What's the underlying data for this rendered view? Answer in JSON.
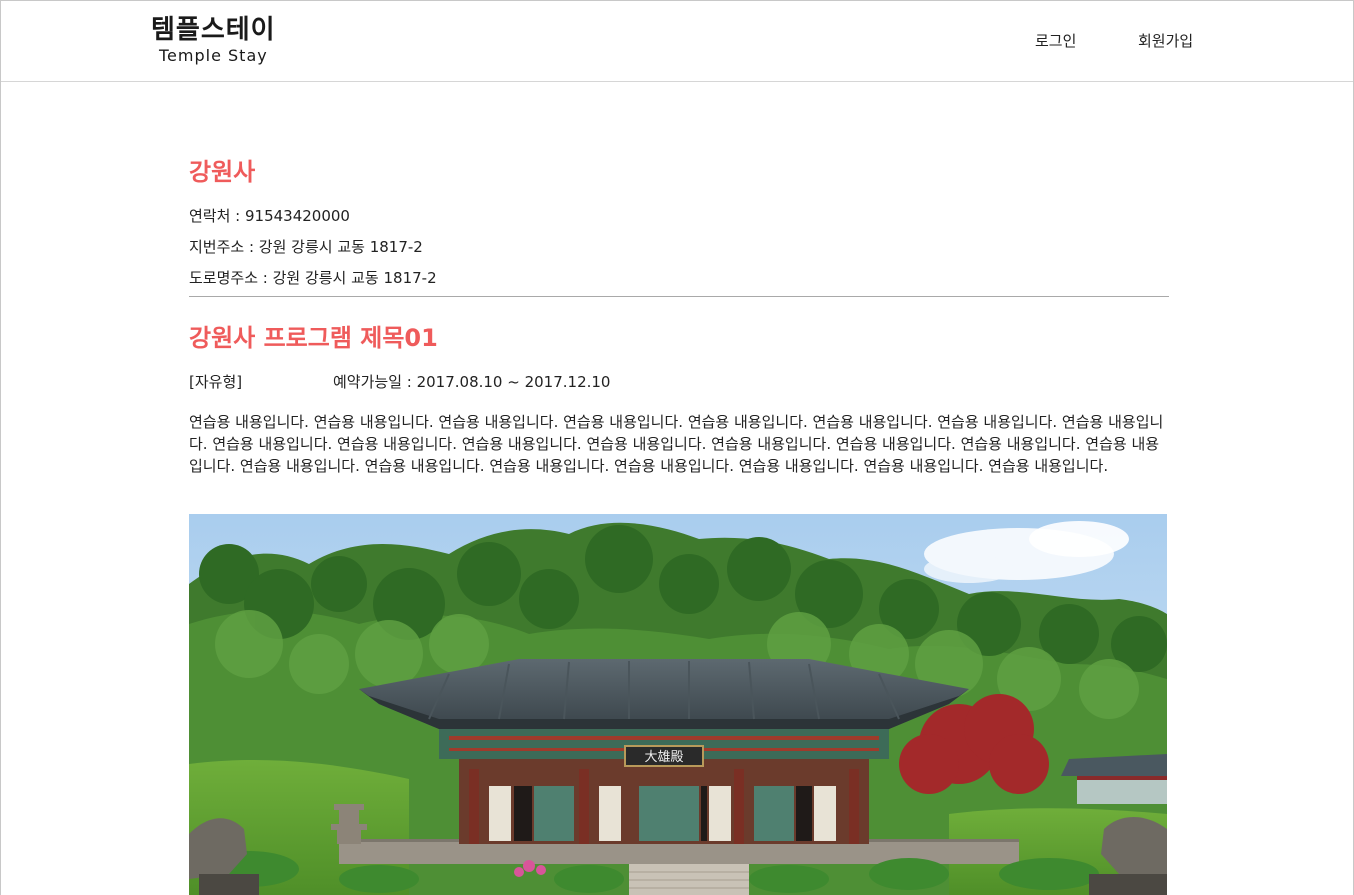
{
  "header": {
    "logo_korean": "템플스테이",
    "logo_english": "Temple Stay",
    "nav_login": "로그인",
    "nav_signup": "회원가입"
  },
  "temple": {
    "name": "강원사",
    "phone": "연락처 : 91543420000",
    "jibun_address": "지번주소 : 강원 강릉시 교동 1817-2",
    "road_address": "도로명주소 : 강원 강릉시 교동 1817-2"
  },
  "program": {
    "title": "강원사 프로그램 제목01",
    "type": "[자유형]",
    "period": "예약가능일 : 2017.08.10 ~ 2017.12.10",
    "description": "연습용 내용입니다. 연습용 내용입니다. 연습용 내용입니다. 연습용 내용입니다. 연습용 내용입니다. 연습용 내용입니다. 연습용 내용입니다. 연습용 내용입니다. 연습용 내용입니다. 연습용 내용입니다. 연습용 내용입니다. 연습용 내용입니다. 연습용 내용입니다. 연습용 내용입니다. 연습용 내용입니다. 연습용 내용입니다. 연습용 내용입니다. 연습용 내용입니다. 연습용 내용입니다. 연습용 내용입니다. 연습용 내용입니다. 연습용 내용입니다. 연습용 내용입니다."
  },
  "photo": {
    "signboard_text": "大雄殿"
  },
  "colors": {
    "accent": "#ef5b5b",
    "text": "#222222",
    "divider": "#a9a9a9"
  }
}
